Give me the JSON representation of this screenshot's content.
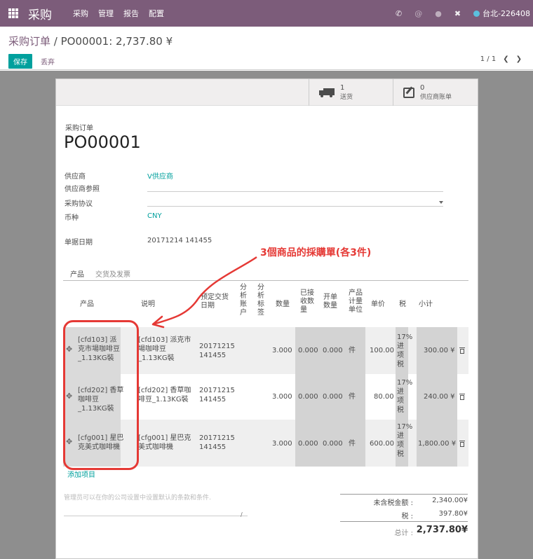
{
  "topbar": {
    "app_title": "采购",
    "menu": [
      "采购",
      "管理",
      "报告",
      "配置"
    ],
    "user": "台北-226408"
  },
  "control_panel": {
    "breadcrumb_parent": "采购订单",
    "breadcrumb_sep": "/",
    "breadcrumb_current": "PO00001: 2,737.80 ¥",
    "save_label": "保存",
    "discard_label": "丢弃",
    "pager": "1 / 1"
  },
  "stat_buttons": {
    "delivery_count": "1",
    "delivery_label": "送货",
    "bills_count": "0",
    "bills_label": "供应商账单"
  },
  "form": {
    "doc_label": "采购订单",
    "doc_name": "PO00001",
    "vendor_label": "供应商",
    "vendor_value": "V供应商",
    "vendor_ref_label": "供应商参照",
    "agreement_label": "采购协议",
    "currency_label": "币种",
    "currency_value": "CNY",
    "order_date_label": "单据日期",
    "order_date_value": "20171214 141455"
  },
  "tabs": [
    "产品",
    "交货及发票"
  ],
  "table": {
    "headers": {
      "product": "产品",
      "description": "说明",
      "schedule": "预定交货日期",
      "analytic_account": "分析账户",
      "analytic_tags": "分析标签",
      "qty": "数量",
      "received": "已接收数量",
      "billed": "开单数量",
      "uom": "产品计量单位",
      "price": "单价",
      "tax": "税",
      "subtotal": "小计"
    },
    "rows": [
      {
        "product": "[cfd103] 派克市場咖啡豆_1.13KG裝",
        "description": "[cfd103] 派克市場咖啡豆_1.13KG裝",
        "date": "20171215 141455",
        "qty": "3.000",
        "received": "0.000",
        "billed": "0.000",
        "uom": "件",
        "price": "100.00",
        "tax": "17%进项税",
        "subtotal": "300.00 ¥"
      },
      {
        "product": "[cfd202] 香草咖啡豆_1.13KG裝",
        "description": "[cfd202] 香草咖啡豆_1.13KG裝",
        "date": "20171215 141455",
        "qty": "3.000",
        "received": "0.000",
        "billed": "0.000",
        "uom": "件",
        "price": "80.00",
        "tax": "17%进项税",
        "subtotal": "240.00 ¥"
      },
      {
        "product": "[cfg001] 星巴克美式咖啡機",
        "description": "[cfg001] 星巴克美式咖啡機",
        "date": "20171215 141455",
        "qty": "3.000",
        "received": "0.000",
        "billed": "0.000",
        "uom": "件",
        "price": "600.00",
        "tax": "17%进项税",
        "subtotal": "1,800.00 ¥"
      }
    ],
    "add_item": "添加项目"
  },
  "terms_placeholder": "管理员可以在你的公司设置中设置默认的条款和条件.",
  "totals": {
    "untaxed_label": "未含税金额 :",
    "untaxed_value": "2,340.00¥",
    "tax_label": "税 :",
    "tax_value": "397.80¥",
    "total_label": "总计 :",
    "total_value": "2,737.80¥"
  },
  "annotation": {
    "text": "3個商品的採購單(各3件)",
    "color": "#e53935"
  },
  "colors": {
    "brand": "#7c5c7a",
    "accent": "#00a09d"
  }
}
